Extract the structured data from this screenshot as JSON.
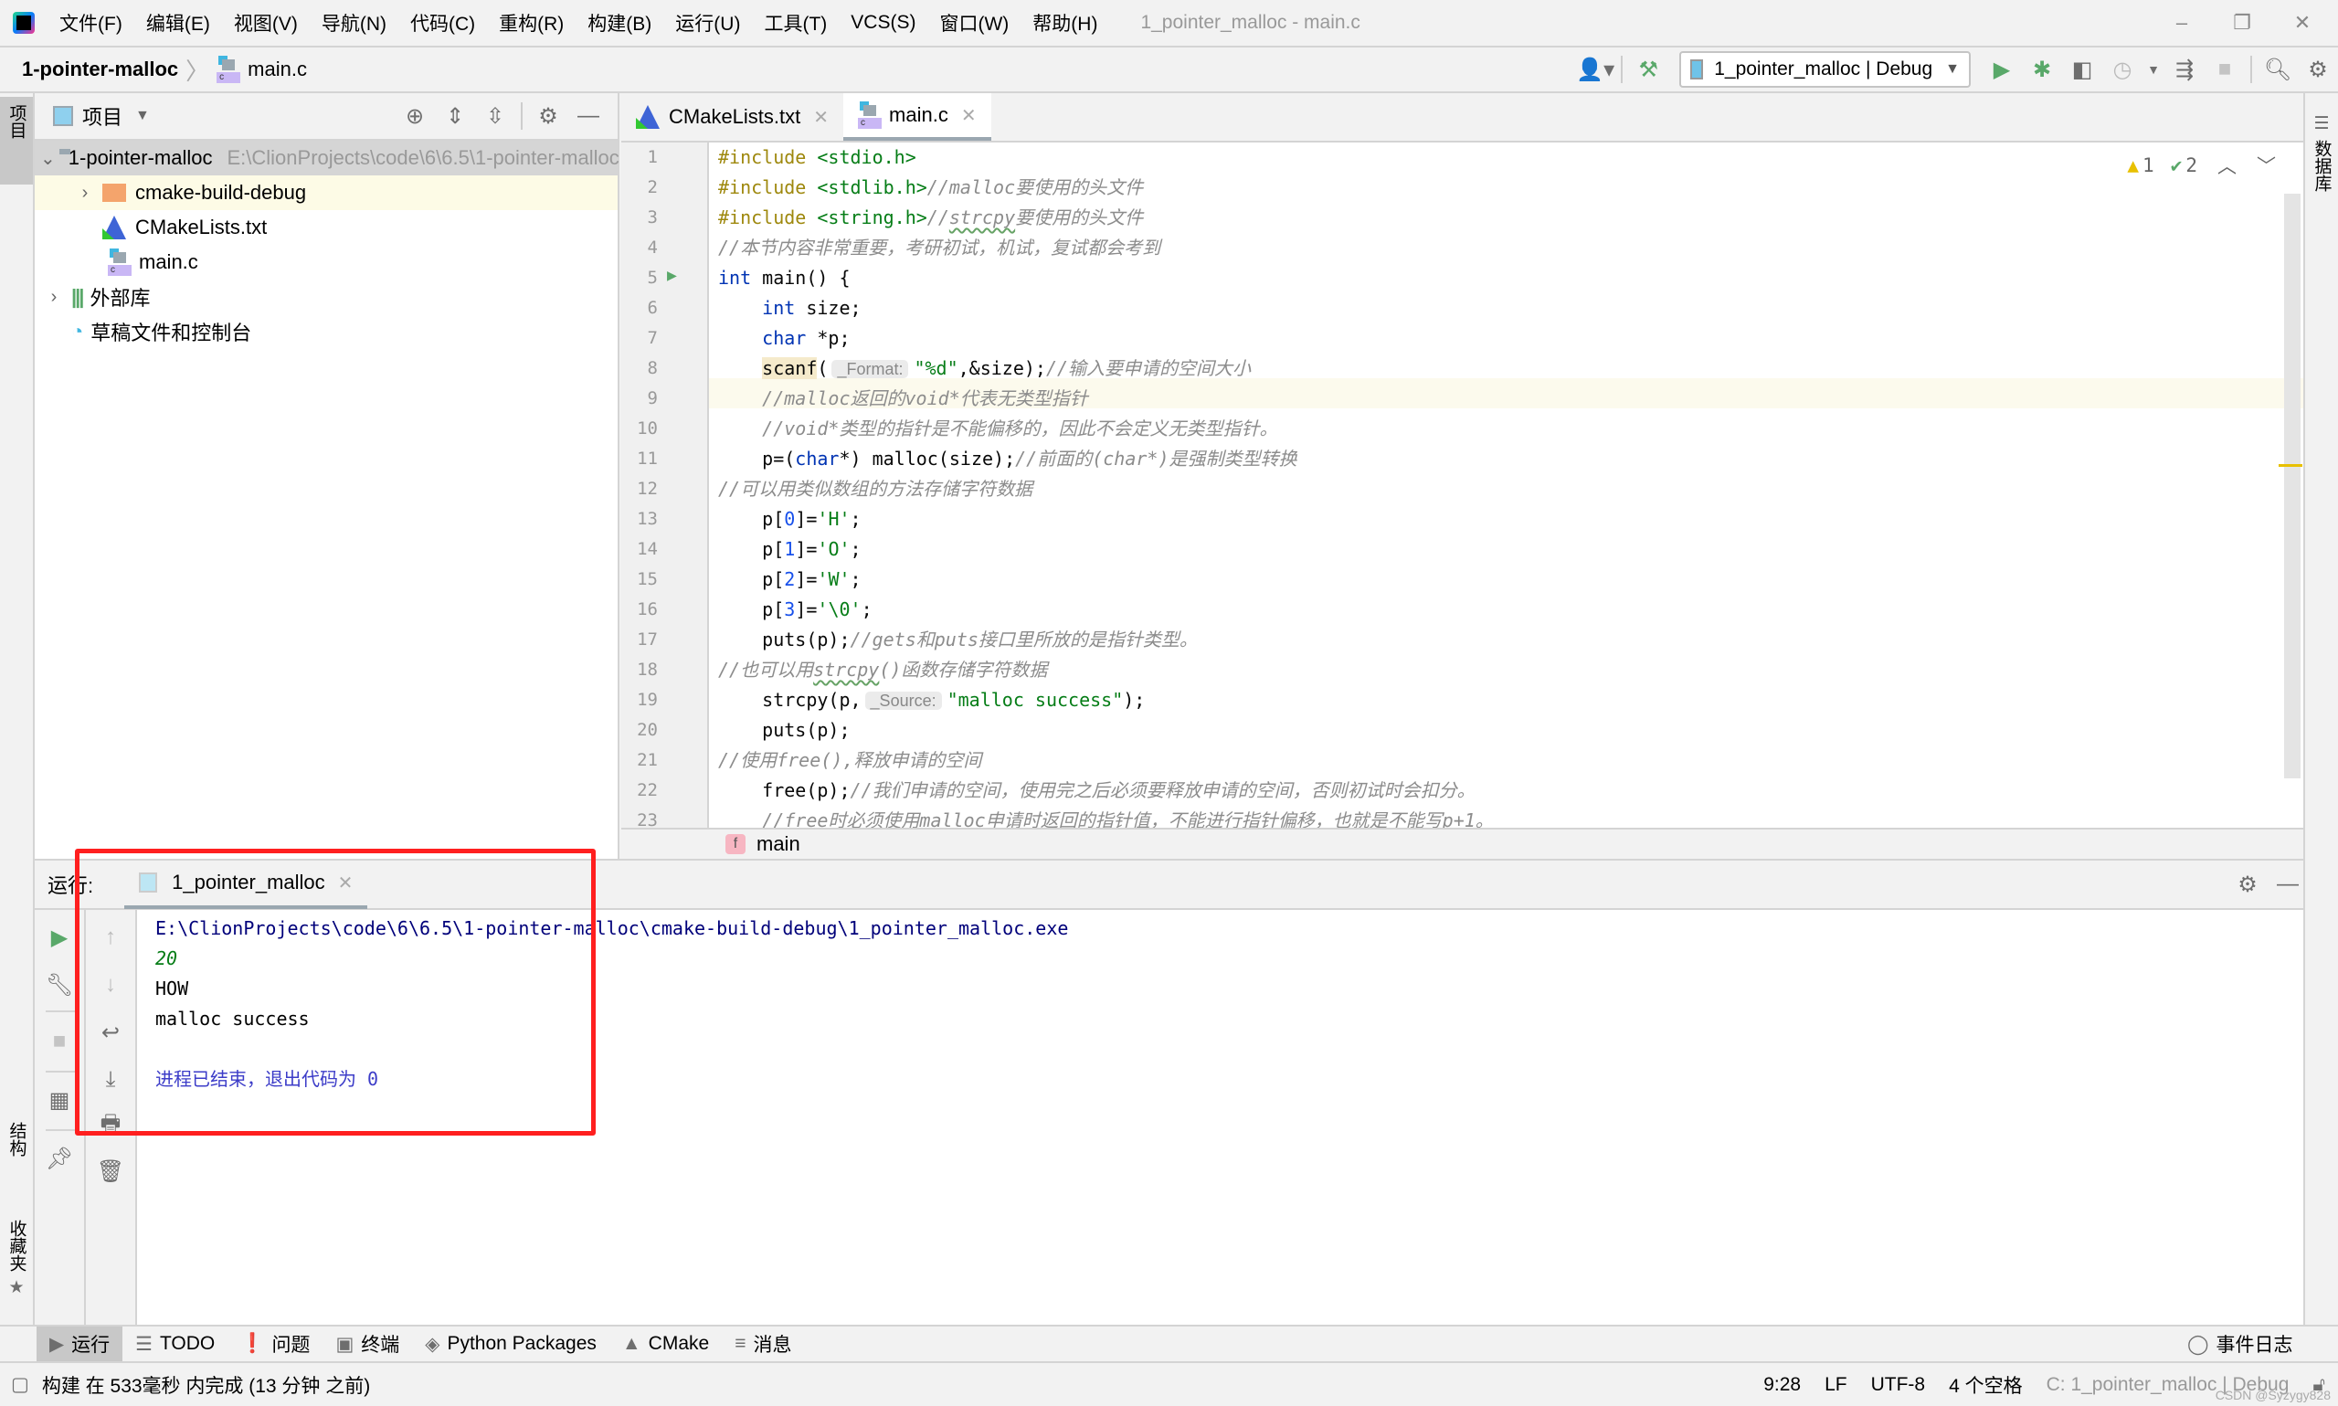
{
  "titlebar": {
    "menus": [
      "文件(F)",
      "编辑(E)",
      "视图(V)",
      "导航(N)",
      "代码(C)",
      "重构(R)",
      "构建(B)",
      "运行(U)",
      "工具(T)",
      "VCS(S)",
      "窗口(W)",
      "帮助(H)"
    ],
    "window_title": "1_pointer_malloc - main.c",
    "controls": {
      "minimize": "–",
      "restore": "❐",
      "close": "✕"
    }
  },
  "navbar": {
    "project": "1-pointer-malloc",
    "file": "main.c",
    "run_config": "1_pointer_malloc | Debug"
  },
  "left_strip": {
    "project_tab": "项目",
    "structure_tab": "结构",
    "favorites_tab": "收藏夹"
  },
  "right_strip": {
    "database_tab": "数据库"
  },
  "project_panel": {
    "title": "项目",
    "tree": [
      {
        "label": "1-pointer-malloc",
        "path": "E:\\ClionProjects\\code\\6\\6.5\\1-pointer-malloc",
        "type": "project-folder",
        "expanded": true
      },
      {
        "label": "cmake-build-debug",
        "type": "build-folder",
        "expanded": false
      },
      {
        "label": "CMakeLists.txt",
        "type": "cmake-file"
      },
      {
        "label": "main.c",
        "type": "c-file"
      },
      {
        "label": "外部库",
        "type": "library",
        "expanded": false
      },
      {
        "label": "草稿文件和控制台",
        "type": "scratches"
      }
    ]
  },
  "editor": {
    "tabs": [
      {
        "label": "CMakeLists.txt",
        "active": false
      },
      {
        "label": "main.c",
        "active": true
      }
    ],
    "inspections": {
      "warnings": "1",
      "weak_warnings": "2"
    },
    "line_numbers": [
      "1",
      "2",
      "3",
      "4",
      "5",
      "6",
      "7",
      "8",
      "9",
      "10",
      "11",
      "12",
      "13",
      "14",
      "15",
      "16",
      "17",
      "18",
      "19",
      "20",
      "21",
      "22",
      "23"
    ],
    "lines": {
      "l1_pp": "#include",
      "l1_inc": " <stdio.h>",
      "l2_pp": "#include",
      "l2_inc": " <stdlib.h>",
      "l2_cm": "//malloc要使用的头文件",
      "l3_pp": "#include",
      "l3_inc": " <string.h>",
      "l3_cm1": "//",
      "l3_sq": "strcpy",
      "l3_cm2": "要使用的头文件",
      "l4_cm": "//本节内容非常重要，考研初试，机试，复试都会考到",
      "l5_kw": "int",
      "l5_rest": " main() {",
      "l6_kw": "int",
      "l6_rest": " size;",
      "l7_kw": "char",
      "l7_rest": " *p;",
      "l8_fn": "scanf",
      "l8_p": "(",
      "l8_hint": "_Format:",
      "l8_str": "\"%d\"",
      "l8_rest": ",&size);",
      "l8_cm": "//输入要申请的空间大小",
      "l9_cm": "//malloc返回的void*代表无类型指针",
      "l10_cm": "//void*类型的指针是不能偏移的，因此不会定义无类型指针。",
      "l11_a": "p=(",
      "l11_kw": "char",
      "l11_b": "*) malloc(size);",
      "l11_cm": "//前面的(char*)是强制类型转换",
      "l12_cm": "//可以用类似数组的方法存储字符数据",
      "l13_a": "p[",
      "l13_n": "0",
      "l13_b": "]=",
      "l13_s": "'H'",
      "l13_c": ";",
      "l14_a": "p[",
      "l14_n": "1",
      "l14_b": "]=",
      "l14_s": "'O'",
      "l14_c": ";",
      "l15_a": "p[",
      "l15_n": "2",
      "l15_b": "]=",
      "l15_s": "'W'",
      "l15_c": ";",
      "l16_a": "p[",
      "l16_n": "3",
      "l16_b": "]=",
      "l16_s": "'\\0'",
      "l16_c": ";",
      "l17_a": "puts(p);",
      "l17_cm": "//gets和puts接口里所放的是指针类型。",
      "l18_cm1": "//也可以用",
      "l18_sq": "strcpy",
      "l18_cm2": "()函数存储字符数据",
      "l19_a": "strcpy(p,",
      "l19_hint": "_Source:",
      "l19_str": "\"malloc success\"",
      "l19_b": ");",
      "l20_a": "puts(p);",
      "l21_cm": "//使用free(),释放申请的空间",
      "l22_a": "free(p);",
      "l22_cm": "//我们申请的空间，使用完之后必须要释放申请的空间，否则初试时会扣分。",
      "l23_cm": "//free时必须使用malloc申请时返回的指针值，不能进行指针偏移，也就是不能写p+1。"
    },
    "breadcrumb_function": "main",
    "breadcrumb_badge": "f"
  },
  "run_panel": {
    "label": "运行:",
    "tab": "1_pointer_malloc",
    "console": {
      "command": "E:\\ClionProjects\\code\\6\\6.5\\1-pointer-malloc\\cmake-build-debug\\1_pointer_malloc.exe",
      "input": "20",
      "out1": "HOW",
      "out2": "malloc success",
      "exit_text": "进程已结束，退出代码为 ",
      "exit_code": "0"
    }
  },
  "tool_tabs": [
    {
      "label": "运行",
      "icon": "▶",
      "active": true
    },
    {
      "label": "TODO",
      "icon": "☰"
    },
    {
      "label": "问题",
      "icon": "❗"
    },
    {
      "label": "终端",
      "icon": "▣"
    },
    {
      "label": "Python Packages",
      "icon": "◈"
    },
    {
      "label": "CMake",
      "icon": "▲"
    },
    {
      "label": "消息",
      "icon": "≡"
    }
  ],
  "event_log": "事件日志",
  "statusbar": {
    "build_msg": "构建 在 533毫秒 内完成 (13 分钟 之前)",
    "position": "9:28",
    "line_sep": "LF",
    "encoding": "UTF-8",
    "indent": "4 个空格",
    "context": "C: 1_pointer_malloc | Debug",
    "watermark": "CSDN @Syzygy828"
  },
  "colors": {
    "run_green": "#59a869",
    "annotation_red": "#ff1f1f",
    "warning_yellow": "#e8c000"
  }
}
